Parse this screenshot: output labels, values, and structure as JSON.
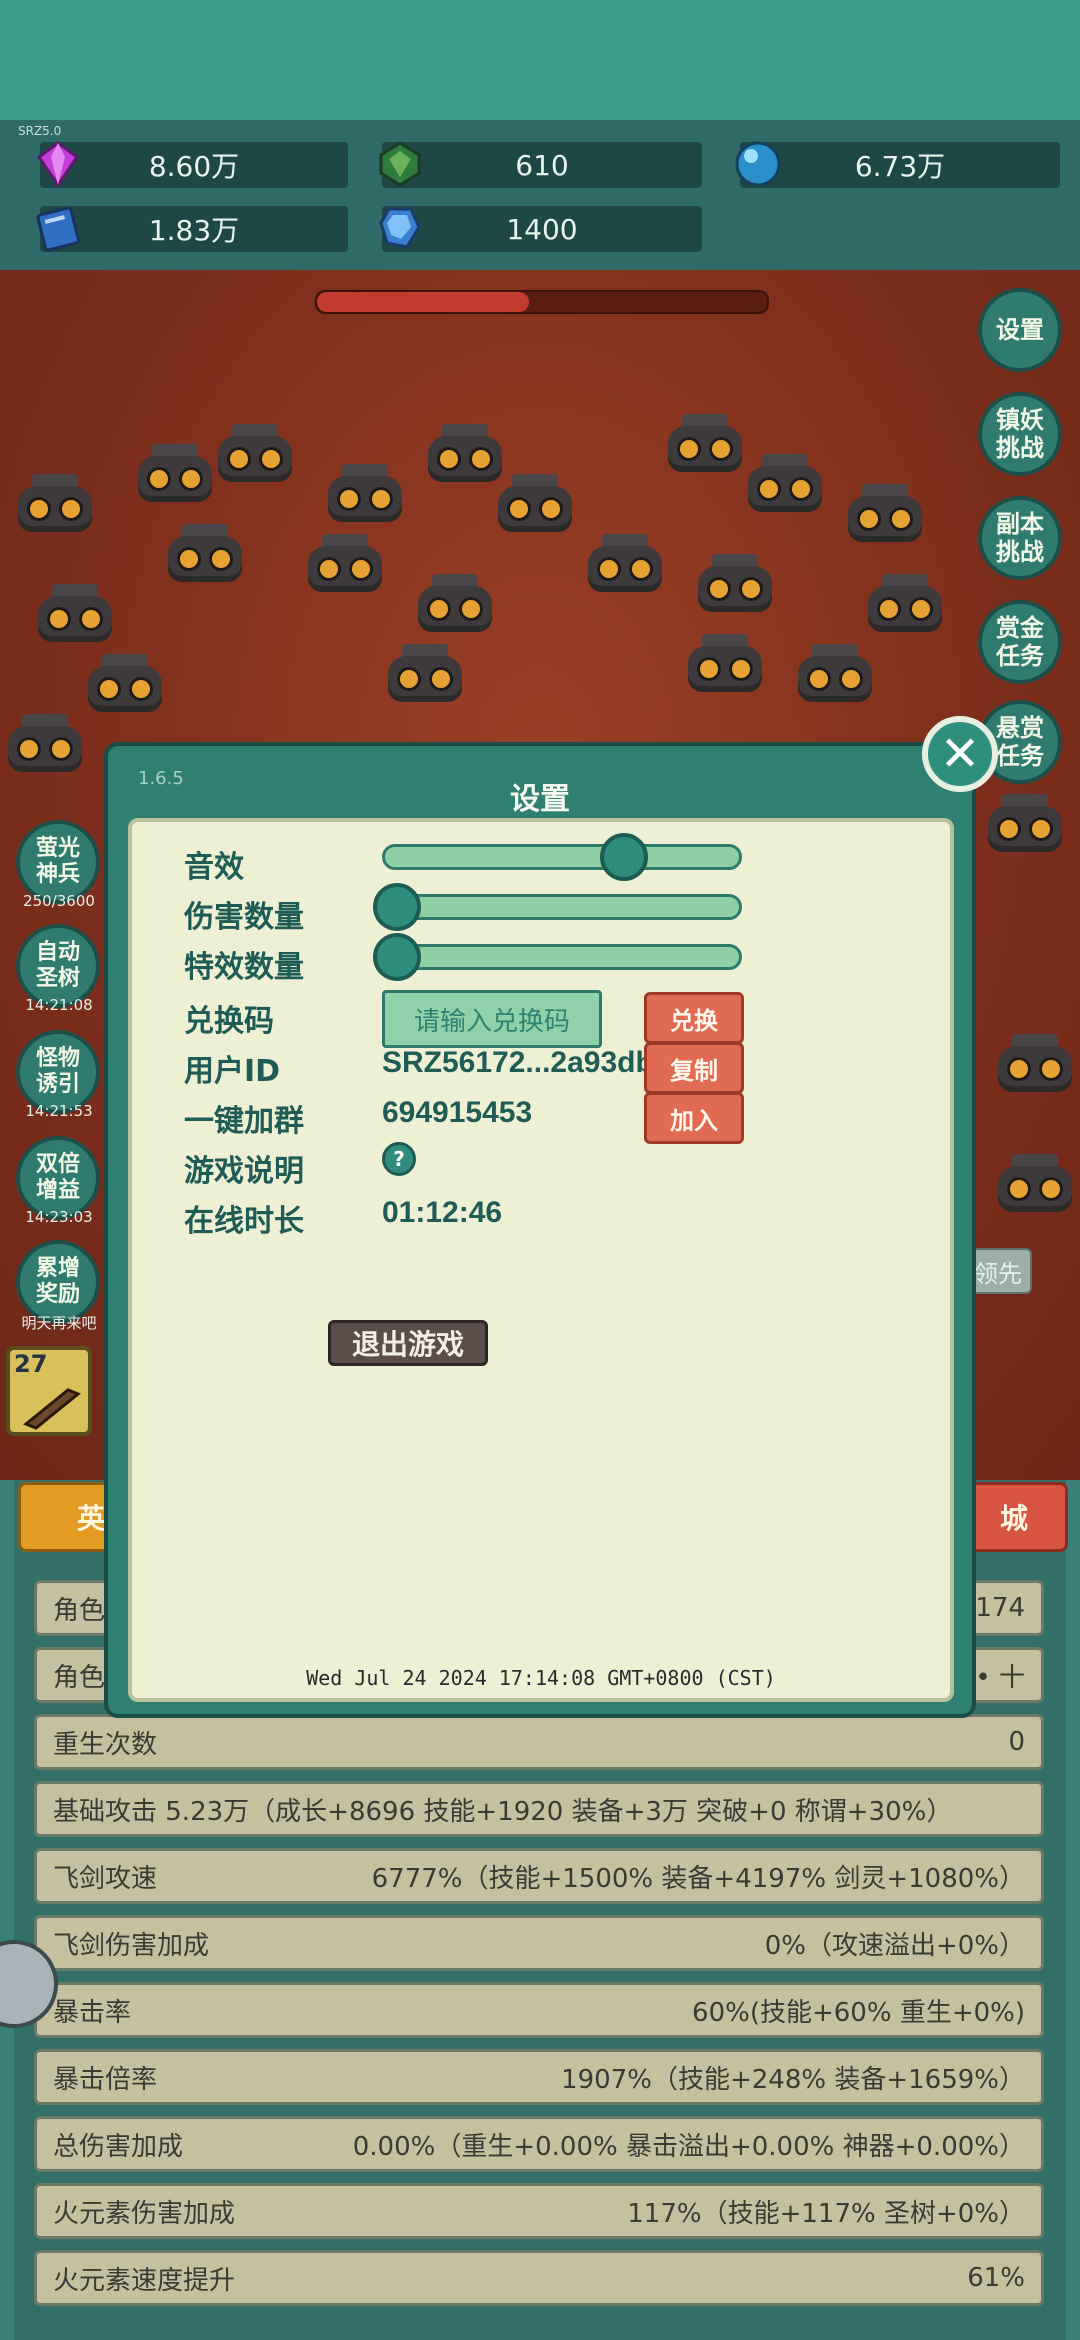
{
  "tiny_label": "SRZ5.0",
  "resources": {
    "gems": "8.60万",
    "emerald": "610",
    "orb": "6.73万",
    "book": "1.83万",
    "crystal": "1400"
  },
  "boss_hp": 0.47,
  "right_buttons": [
    "设置",
    "镇妖\n挑战",
    "副本\n挑战",
    "赏金\n任务",
    "悬赏\n任务"
  ],
  "left_buttons": [
    {
      "label": "萤光\n神兵",
      "sub": "250/3600"
    },
    {
      "label": "自动\n圣树",
      "sub": "14:21:08"
    },
    {
      "label": "怪物\n诱引",
      "sub": "14:21:53"
    },
    {
      "label": "双倍\n增益",
      "sub": "14:23:03"
    },
    {
      "label": "累增\n奖励",
      "sub": "明天再来吧"
    }
  ],
  "level_badge": "27",
  "tabs": {
    "left": "英",
    "right": "城",
    "hidden_right": "领先"
  },
  "stats": [
    {
      "label": "角色",
      "value": "174"
    },
    {
      "label": "角色",
      "value": "• 十"
    },
    {
      "label": "重生次数",
      "value": "0"
    },
    {
      "label": "基础攻击   5.23万（成长+8696 技能+1920 装备+3万 突破+0 称谓+30%）",
      "value": ""
    },
    {
      "label": "飞剑攻速",
      "value": "6777%（技能+1500% 装备+4197% 剑灵+1080%）"
    },
    {
      "label": "飞剑伤害加成",
      "value": "0%（攻速溢出+0%）"
    },
    {
      "label": "暴击率",
      "value": "60%(技能+60% 重生+0%)"
    },
    {
      "label": "暴击倍率",
      "value": "1907%（技能+248% 装备+1659%）"
    },
    {
      "label": "总伤害加成",
      "value": "0.00%（重生+0.00% 暴击溢出+0.00% 神器+0.00%）"
    },
    {
      "label": "火元素伤害加成",
      "value": "117%（技能+117% 圣树+0%）"
    },
    {
      "label": "火元素速度提升",
      "value": "61%"
    }
  ],
  "settings": {
    "version": "1.6.5",
    "title": "设置",
    "sound_label": "音效",
    "sound_level": 0.7,
    "damage_count_label": "伤害数量",
    "damage_level": 0.0,
    "effect_count_label": "特效数量",
    "effect_level": 0.0,
    "redeem_label": "兑换码",
    "redeem_placeholder": "请输入兑换码",
    "redeem_button": "兑换",
    "userid_label": "用户ID",
    "userid_value": "SRZ56172...2a93dbcf",
    "copy_button": "复制",
    "group_label": "一键加群",
    "group_value": "694915453",
    "join_button": "加入",
    "help_label": "游戏说明",
    "help_icon": "?",
    "online_label": "在线时长",
    "online_value": "01:12:46",
    "exit_button": "退出游戏",
    "datetime": "Wed Jul 24 2024 17:14:08 GMT+0800 (CST)"
  },
  "colors": {
    "accent": "#2f8c7e",
    "danger": "#e06a52",
    "panel": "#eef0d4"
  }
}
